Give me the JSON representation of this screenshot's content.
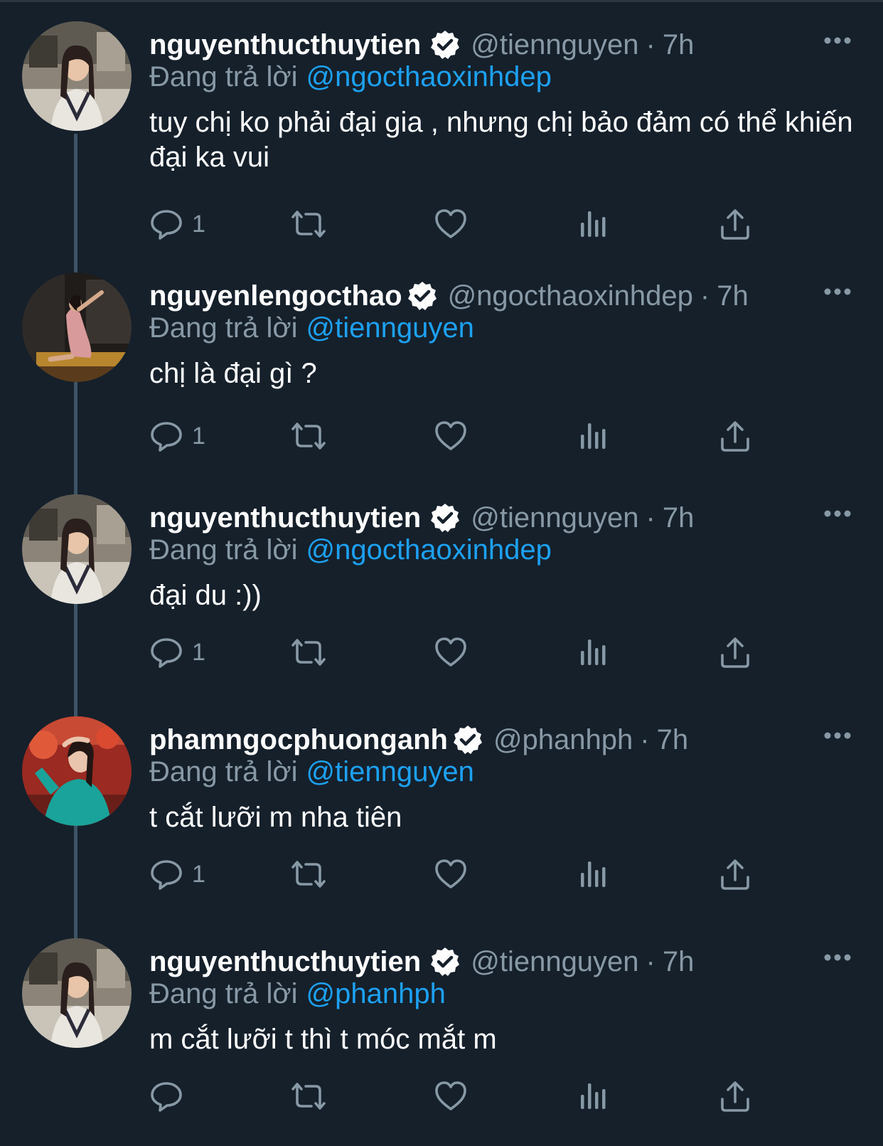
{
  "colors": {
    "background": "#15202b",
    "text": "#ffffff",
    "secondary": "#8899a6",
    "link": "#1da1f2",
    "thread_line": "#3d5466"
  },
  "reply_prefix": "Đang trả lời",
  "tweets": [
    {
      "name": "nguyenthucthuytien",
      "handle": "@tiennguyen",
      "separator": "·",
      "time": "7h",
      "reply_to": "@ngocthaoxinhdep",
      "text": "tuy chị ko phải đại gia , nhưng chị bảo đảm có thể khiến đại ka vui",
      "reply_count": "1",
      "avatar_icon": "avatar-thuytien"
    },
    {
      "name": "nguyenlengocthao",
      "handle": "@ngocthaoxinhdep",
      "separator": "·",
      "time": "7h",
      "reply_to": "@tiennguyen",
      "text": "chị là đại gì ?",
      "reply_count": "1",
      "avatar_icon": "avatar-ngocthao"
    },
    {
      "name": "nguyenthucthuytien",
      "handle": "@tiennguyen",
      "separator": "·",
      "time": "7h",
      "reply_to": "@ngocthaoxinhdep",
      "text": "đại du :))",
      "reply_count": "1",
      "avatar_icon": "avatar-thuytien"
    },
    {
      "name": "phamngocphuonganh",
      "handle": "@phanhph",
      "separator": "·",
      "time": "7h",
      "reply_to": "@tiennguyen",
      "text": "t cắt lưỡi m nha tiên",
      "reply_count": "1",
      "avatar_icon": "avatar-phuonganh"
    },
    {
      "name": "nguyenthucthuytien",
      "handle": "@tiennguyen",
      "separator": "·",
      "time": "7h",
      "reply_to": "@phanhph",
      "text": "m cắt lưỡi t thì t móc mắt m",
      "reply_count": "",
      "avatar_icon": "avatar-thuytien"
    }
  ]
}
